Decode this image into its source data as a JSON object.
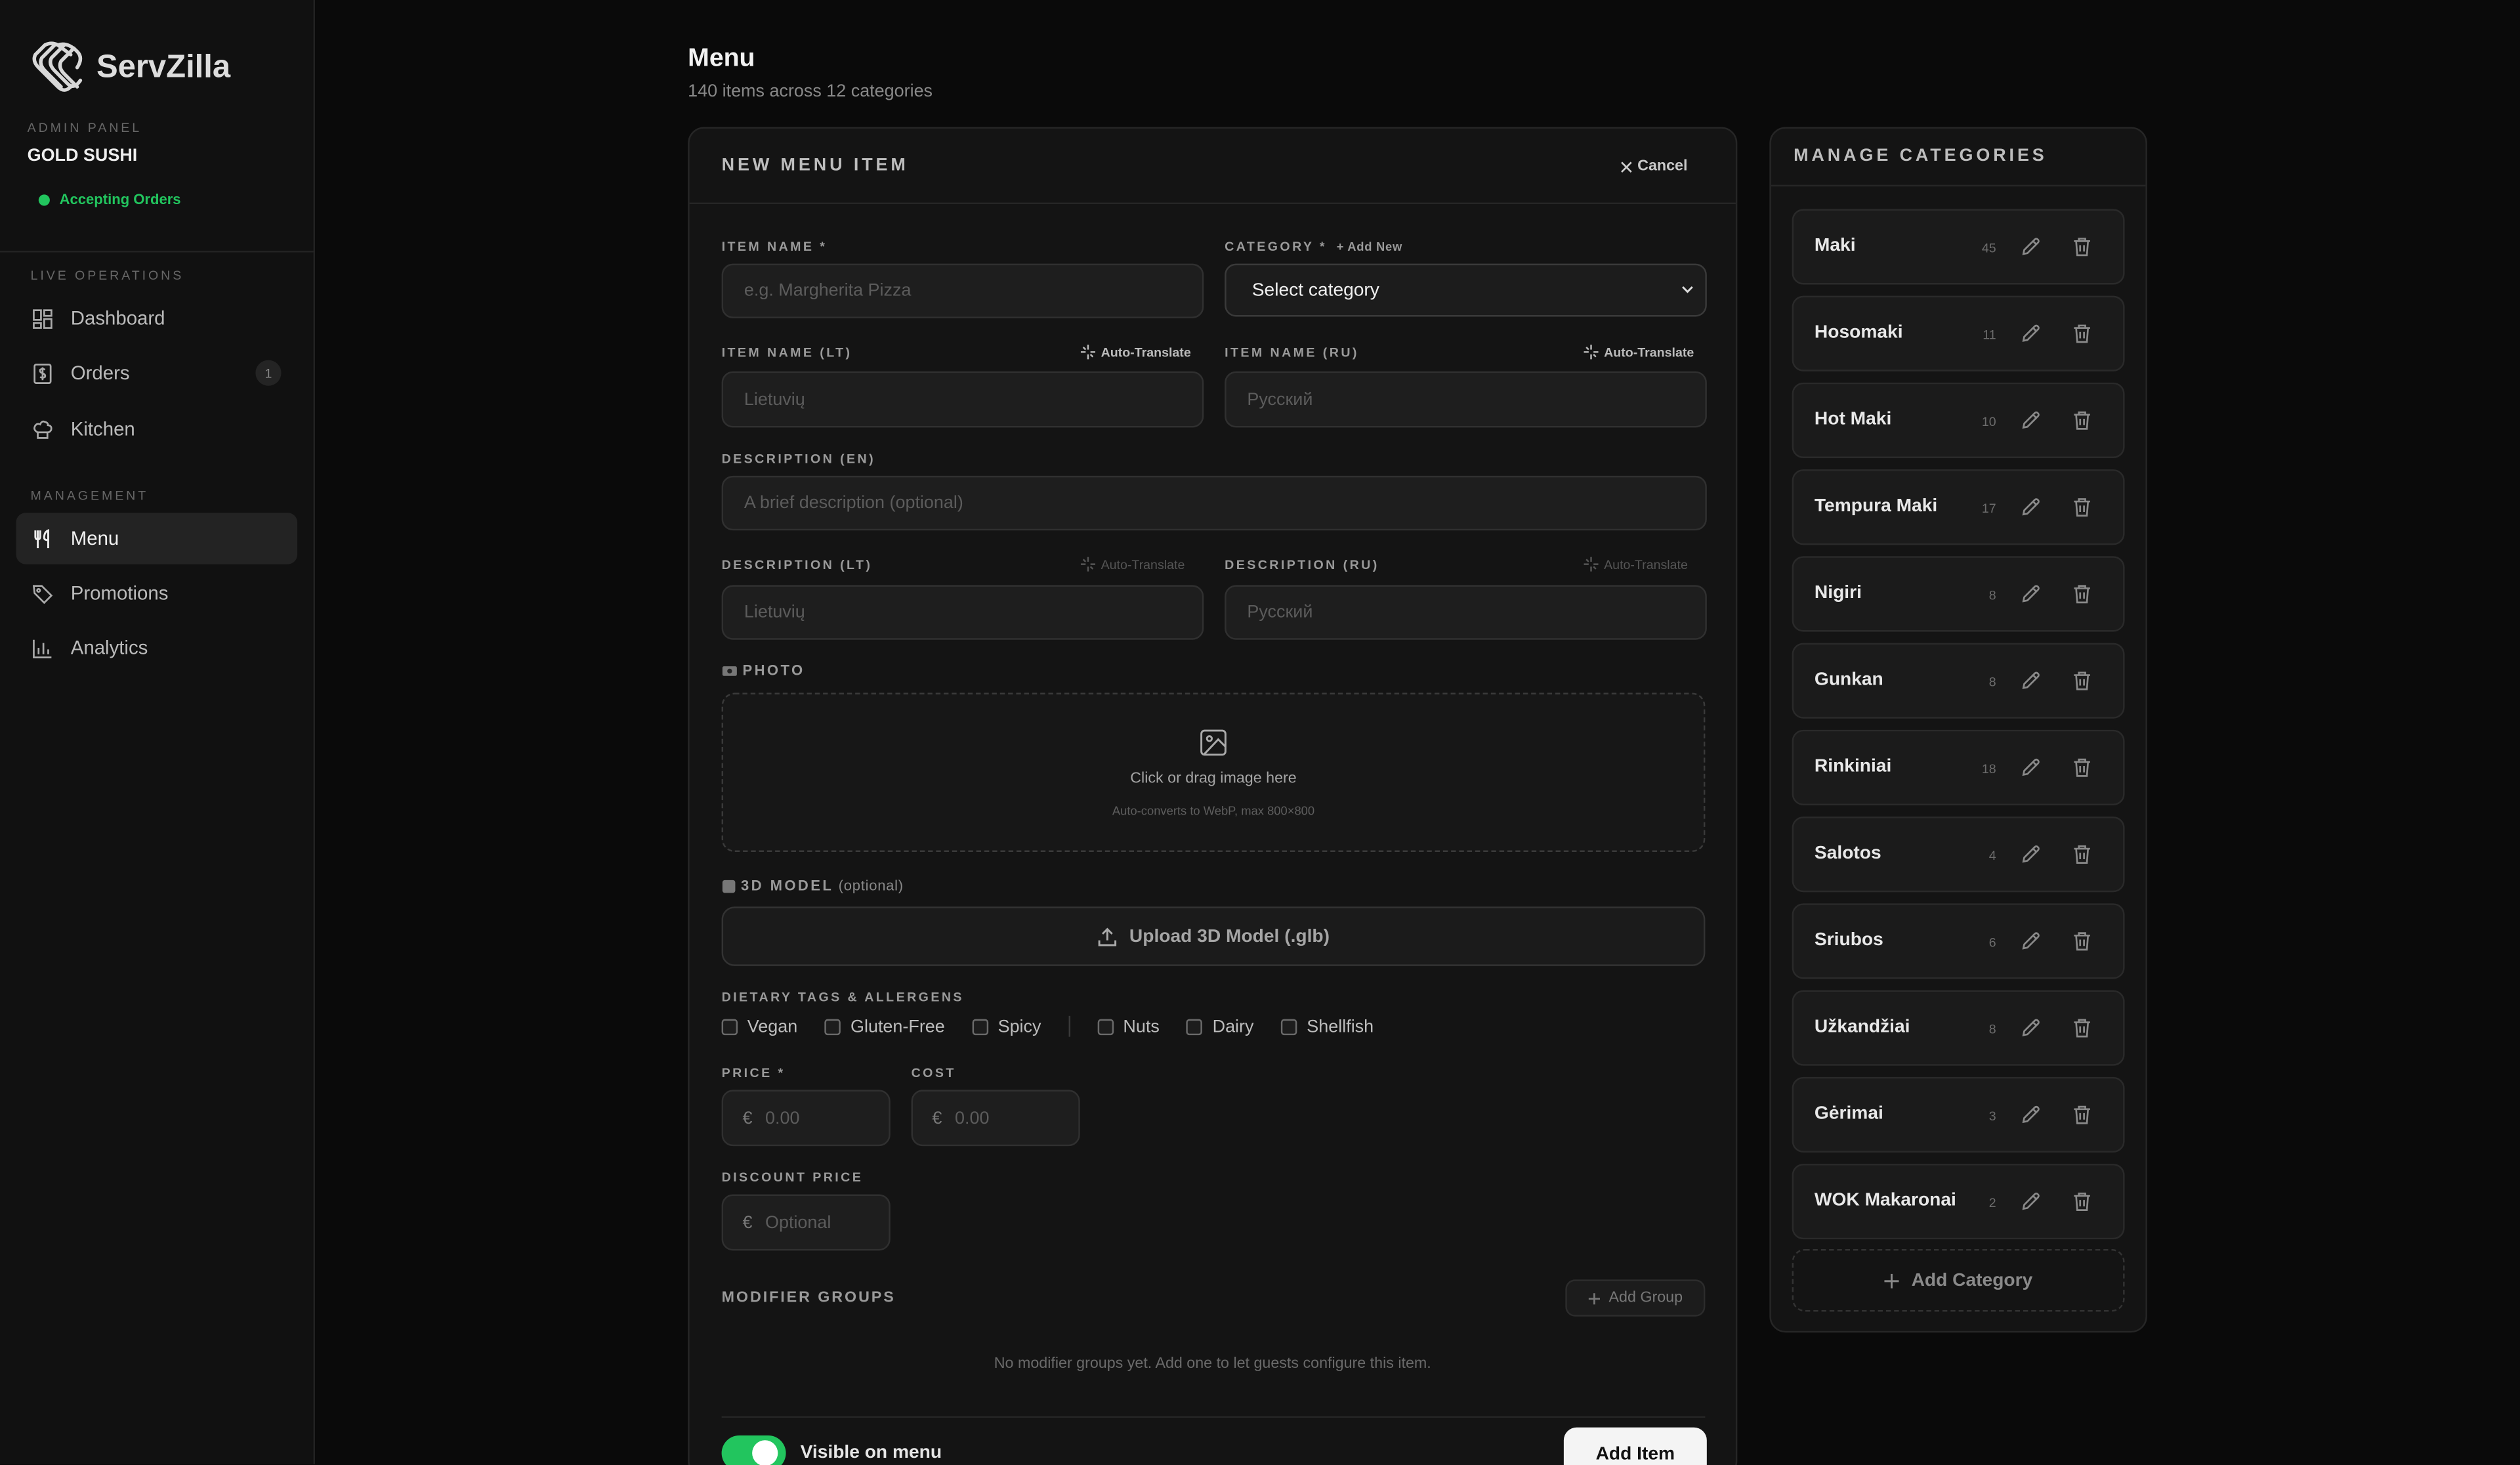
{
  "app": {
    "name": "ServZilla",
    "admin_label": "ADMIN PANEL",
    "restaurant": "GOLD SUSHI",
    "status": "Accepting Orders",
    "status_color": "#22c55e"
  },
  "sidebar": {
    "live_label": "LIVE OPERATIONS",
    "live_items": [
      {
        "label": "Dashboard",
        "icon": "dashboard-icon"
      },
      {
        "label": "Orders",
        "icon": "dollar-receipt-icon",
        "badge": "1"
      },
      {
        "label": "Kitchen",
        "icon": "chef-hat-icon"
      }
    ],
    "management_label": "MANAGEMENT",
    "management_items": [
      {
        "label": "Menu",
        "icon": "utensils-icon",
        "active": true
      },
      {
        "label": "Promotions",
        "icon": "tag-icon"
      },
      {
        "label": "Analytics",
        "icon": "bar-chart-icon"
      }
    ]
  },
  "header": {
    "title": "Menu",
    "subtitle": "140 items across 12 categories"
  },
  "form": {
    "title": "NEW MENU ITEM",
    "cancel": "Cancel",
    "item_name": {
      "label": "ITEM NAME *",
      "placeholder": "e.g. Margherita Pizza"
    },
    "category": {
      "label": "CATEGORY *",
      "add_new": "+ Add New",
      "value": "Select category"
    },
    "item_name_lt": {
      "label": "ITEM NAME (LT)",
      "placeholder": "Lietuvių",
      "auto": "Auto-Translate"
    },
    "item_name_ru": {
      "label": "ITEM NAME (RU)",
      "placeholder": "Русский",
      "auto": "Auto-Translate"
    },
    "description_en": {
      "label": "DESCRIPTION (EN)",
      "placeholder": "A brief description (optional)"
    },
    "description_lt": {
      "label": "DESCRIPTION (LT)",
      "placeholder": "Lietuvių",
      "auto": "Auto-Translate"
    },
    "description_ru": {
      "label": "DESCRIPTION (RU)",
      "placeholder": "Русский",
      "auto": "Auto-Translate"
    },
    "photo": {
      "label": "PHOTO",
      "prompt": "Click or drag image here",
      "hint": "Auto-converts to WebP, max 800×800"
    },
    "model3d": {
      "label": "3D MODEL",
      "optional": "(optional)",
      "button": "Upload 3D Model (.glb)"
    },
    "dietary": {
      "label": "DIETARY TAGS & ALLERGENS",
      "diet_tags": [
        "Vegan",
        "Gluten-Free",
        "Spicy"
      ],
      "allergen_tags": [
        "Nuts",
        "Dairy",
        "Shellfish"
      ]
    },
    "price": {
      "label": "PRICE *",
      "currency": "€",
      "placeholder": "0.00"
    },
    "cost": {
      "label": "COST",
      "currency": "€",
      "placeholder": "0.00"
    },
    "discount": {
      "label": "DISCOUNT PRICE",
      "currency": "€",
      "placeholder": "Optional"
    },
    "modifiers": {
      "title": "MODIFIER GROUPS",
      "add_button": "Add Group",
      "empty": "No modifier groups yet. Add one to let guests configure this item."
    },
    "visible": {
      "label": "Visible on menu",
      "on": true
    },
    "submit": "Add Item"
  },
  "categories": {
    "title": "MANAGE CATEGORIES",
    "items": [
      {
        "name": "Maki",
        "count": "45"
      },
      {
        "name": "Hosomaki",
        "count": "11"
      },
      {
        "name": "Hot Maki",
        "count": "10"
      },
      {
        "name": "Tempura Maki",
        "count": "17"
      },
      {
        "name": "Nigiri",
        "count": "8"
      },
      {
        "name": "Gunkan",
        "count": "8"
      },
      {
        "name": "Rinkiniai",
        "count": "18"
      },
      {
        "name": "Salotos",
        "count": "4"
      },
      {
        "name": "Sriubos",
        "count": "6"
      },
      {
        "name": "Užkandžiai",
        "count": "8"
      },
      {
        "name": "Gėrimai",
        "count": "3"
      },
      {
        "name": "WOK Makaronai",
        "count": "2"
      }
    ],
    "add_button": "Add Category"
  }
}
